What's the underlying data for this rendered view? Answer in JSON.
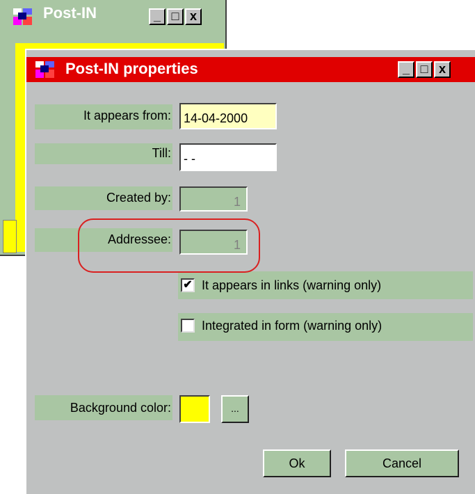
{
  "back_window": {
    "title": "Post-IN",
    "buttons": {
      "minimize": "_",
      "maximize": "□",
      "close": "x"
    },
    "background_color": "#ffff00"
  },
  "dialog": {
    "title": "Post-IN properties",
    "buttons": {
      "minimize": "_",
      "maximize": "□",
      "close": "x"
    },
    "fields": {
      "appears_from": {
        "label": "It appears from:",
        "value": "14-04-2000"
      },
      "till": {
        "label": "Till:",
        "value": "- -"
      },
      "created_by": {
        "label": "Created by:",
        "value": "1"
      },
      "addressee": {
        "label": "Addressee:",
        "value": "1"
      }
    },
    "checkboxes": {
      "appears_in_links": {
        "label": "It appears in links (warning only)",
        "checked": true,
        "mark": "✔"
      },
      "integrated_in_form": {
        "label": "Integrated in form (warning only)",
        "checked": false,
        "mark": ""
      }
    },
    "background": {
      "label": "Background color:",
      "swatch_color": "#ffff00",
      "browse_label": "..."
    },
    "actions": {
      "ok": "Ok",
      "cancel": "Cancel"
    }
  },
  "highlight_color": "#d92020",
  "colors": {
    "label_band": "#a9c6a3",
    "dialog_bg": "#bfc1c1",
    "title_bar": "#e00000"
  }
}
